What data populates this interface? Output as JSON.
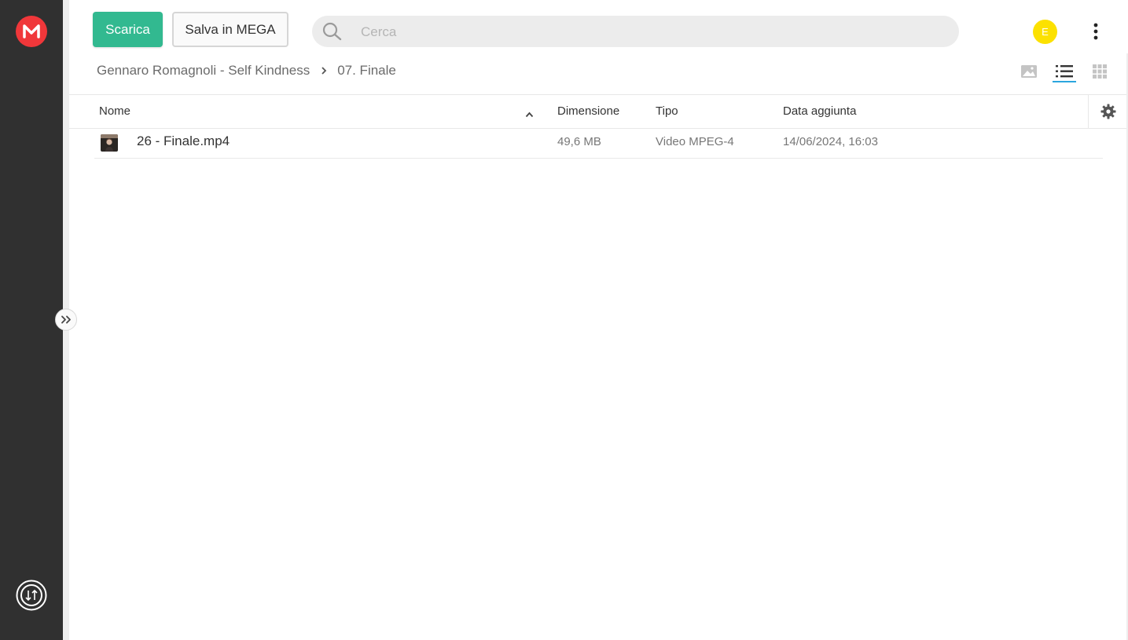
{
  "toolbar": {
    "download_label": "Scarica",
    "save_label": "Salva in MEGA"
  },
  "search": {
    "placeholder": "Cerca"
  },
  "user": {
    "initial": "E",
    "avatar_color": "#fce100"
  },
  "breadcrumb": {
    "parent": "Gennaro Romagnoli - Self Kindness",
    "current": "07. Finale"
  },
  "view_modes": {
    "options": [
      "media-view",
      "list-view",
      "grid-view"
    ],
    "active": "list-view"
  },
  "table": {
    "columns": {
      "name": "Nome",
      "size": "Dimensione",
      "type": "Tipo",
      "date": "Data aggiunta"
    },
    "sort": {
      "column": "name",
      "direction": "ascending"
    },
    "rows": [
      {
        "name": "26 - Finale.mp4",
        "size": "49,6 MB",
        "type": "Video MPEG-4",
        "date": "14/06/2024, 16:03"
      }
    ]
  },
  "colors": {
    "brand": "#f0373a",
    "download_button": "#32b990",
    "sidebar": "#303030",
    "active_view_indicator": "#2ba6de"
  },
  "icons": {
    "logo": "mega-logo-icon",
    "transfers": "transfers-icon",
    "expand": "double-chevron-right-icon",
    "search": "search-icon",
    "menu": "kebab-menu-icon",
    "breadcrumb_separator": "chevron-right-icon",
    "sort": "chevron-up-icon",
    "settings": "gear-icon",
    "file_thumbnail": "video-thumbnail-icon"
  }
}
